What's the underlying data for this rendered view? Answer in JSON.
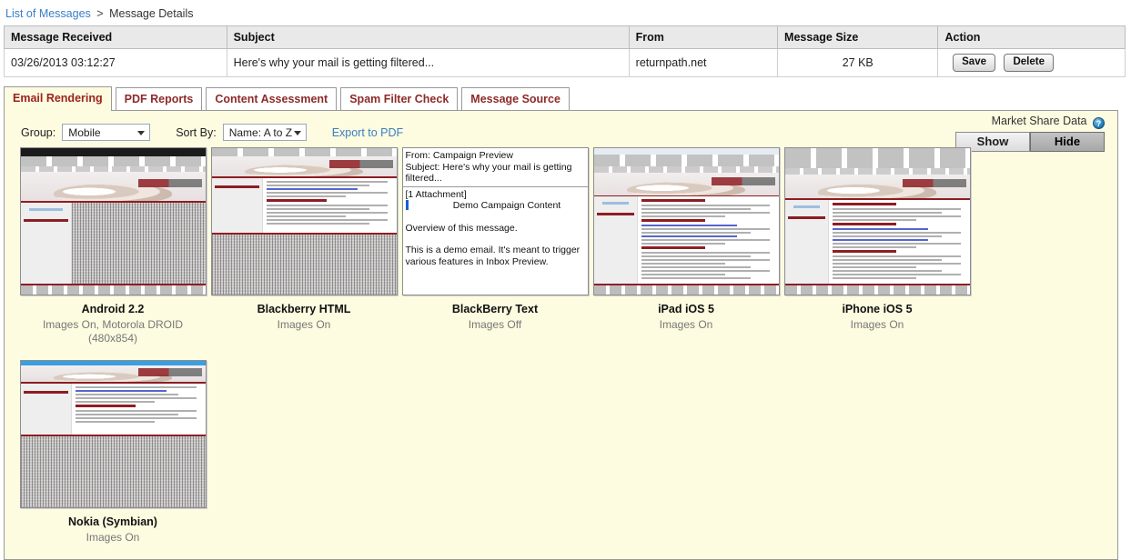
{
  "breadcrumb": {
    "parent": "List of Messages",
    "separator": ">",
    "current": "Message Details"
  },
  "message_table": {
    "columns": [
      "Message Received",
      "Subject",
      "From",
      "Message Size",
      "Action"
    ],
    "row": {
      "received": "03/26/2013 03:12:27",
      "subject": "Here's why your mail is getting filtered...",
      "from": "returnpath.net",
      "size": "27 KB",
      "save_label": "Save",
      "delete_label": "Delete"
    }
  },
  "tabs": [
    {
      "label": "Email Rendering",
      "active": true
    },
    {
      "label": "PDF Reports",
      "active": false
    },
    {
      "label": "Content Assessment",
      "active": false
    },
    {
      "label": "Spam Filter Check",
      "active": false
    },
    {
      "label": "Message Source",
      "active": false
    }
  ],
  "toolbar": {
    "group_label": "Group:",
    "group_value": "Mobile",
    "sort_label": "Sort By:",
    "sort_value": "Name: A to Z",
    "export_label": "Export to PDF",
    "market_share_label": "Market Share Data",
    "help_icon_glyph": "?",
    "show_label": "Show",
    "hide_label": "Hide",
    "active_market_share_button": "Hide"
  },
  "previews": [
    {
      "name": "Android 2.2",
      "subtitle": "Images On, Motorola DROID (480x854)",
      "render_type": "html",
      "images": "On"
    },
    {
      "name": "Blackberry HTML",
      "subtitle": "Images On",
      "render_type": "html-noise",
      "images": "On"
    },
    {
      "name": "BlackBerry Text",
      "subtitle": "Images Off",
      "render_type": "text",
      "images": "Off",
      "text_render": {
        "from_line": "From: Campaign Preview",
        "subject_line": "Subject: Here's why your mail is getting filtered...",
        "attachment_line": "[1 Attachment]",
        "content_title": "Demo Campaign Content",
        "paragraph1": "Overview of this message.",
        "paragraph2": "This is a demo email.  It's meant to trigger various features in Inbox Preview."
      }
    },
    {
      "name": "iPad iOS 5",
      "subtitle": "Images On",
      "render_type": "html-ios",
      "images": "On"
    },
    {
      "name": "iPhone iOS 5",
      "subtitle": "Images On",
      "render_type": "html-ios",
      "images": "On"
    },
    {
      "name": "Nokia (Symbian)",
      "subtitle": "Images On",
      "render_type": "html-nokia",
      "images": "On"
    }
  ],
  "colors": {
    "panel_background": "#fdfbe0",
    "tab_text": "#8e2a2a",
    "link": "#3a7fc4",
    "table_header": "#e9e9e9",
    "email_accent": "#8e1d22"
  }
}
